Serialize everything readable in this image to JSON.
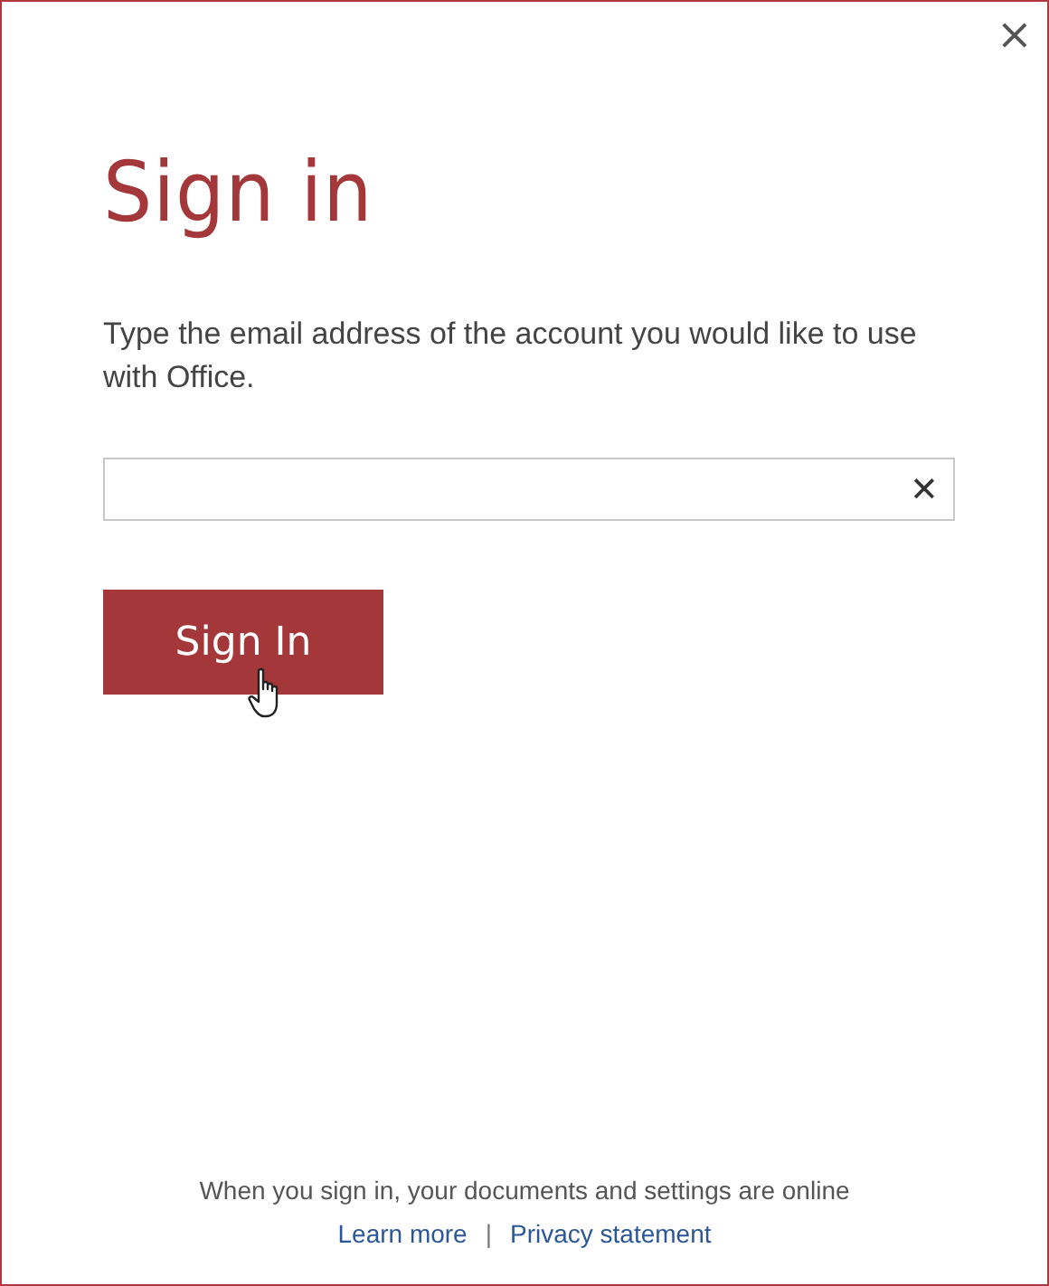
{
  "dialog": {
    "close": "×",
    "title": "Sign in",
    "prompt": "Type the email address of the account you would like to use with Office.",
    "email_field": {
      "clear": "✕"
    },
    "submit": {
      "label": "Sign In",
      "hovered": true
    },
    "footer": {
      "note": "When you sign in, your documents and settings are online",
      "links": [
        {
          "label": "Learn more"
        },
        {
          "label": "Privacy statement"
        }
      ],
      "separator": "|"
    }
  }
}
